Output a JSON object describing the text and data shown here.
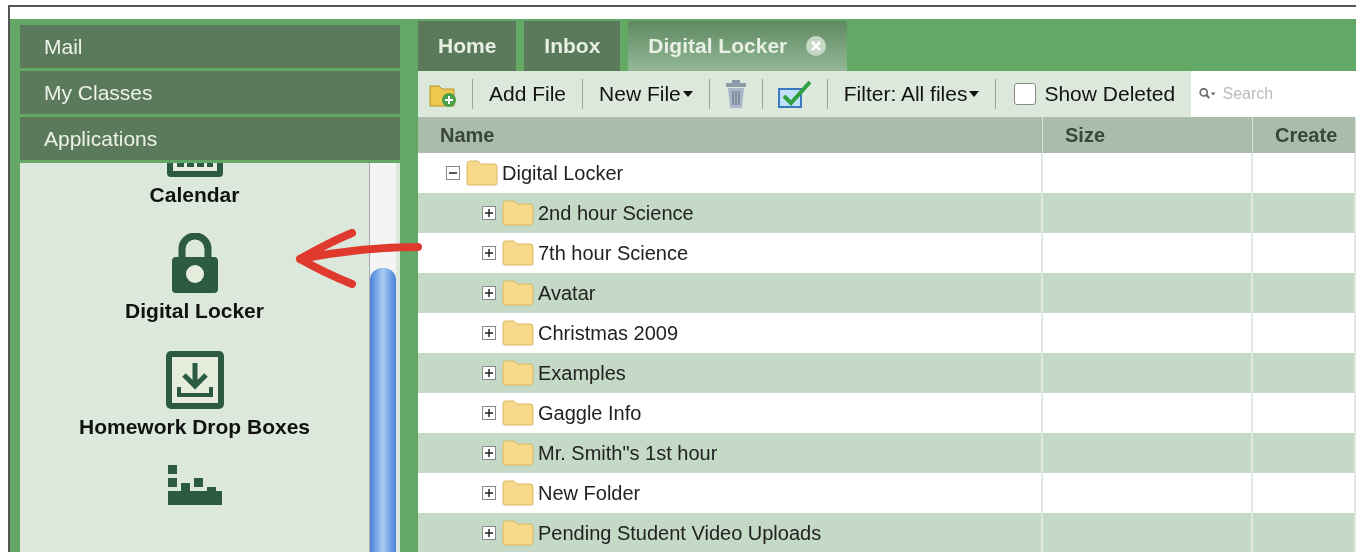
{
  "sidebar": {
    "sections": [
      {
        "label": "Mail"
      },
      {
        "label": "My Classes"
      },
      {
        "label": "Applications"
      }
    ],
    "apps": [
      {
        "kind": "calendar",
        "label": "Calendar"
      },
      {
        "kind": "lock",
        "label": "Digital Locker"
      },
      {
        "kind": "dropbox",
        "label": "Homework Drop Boxes"
      },
      {
        "kind": "pixels"
      }
    ]
  },
  "tabs": [
    {
      "label": "Home",
      "selected": false,
      "closable": false
    },
    {
      "label": "Inbox",
      "selected": false,
      "closable": false
    },
    {
      "label": "Digital Locker",
      "selected": true,
      "closable": true
    }
  ],
  "toolbar": {
    "items": [
      {
        "kind": "icon-folder"
      },
      {
        "kind": "button",
        "label": "Add File"
      },
      {
        "kind": "menu",
        "label": "New File"
      },
      {
        "kind": "icon-trash"
      },
      {
        "kind": "icon-check"
      },
      {
        "kind": "menu",
        "label": "Filter: All files"
      },
      {
        "kind": "checkbox",
        "label": "Show Deleted",
        "checked": false
      }
    ],
    "search": {
      "placeholder": "Search"
    }
  },
  "table": {
    "columns": [
      "Name",
      "Size",
      "Create"
    ],
    "tree": [
      {
        "name": "Digital Locker",
        "expanded": true,
        "children": [
          {
            "name": "2nd hour Science",
            "expanded": false
          },
          {
            "name": "7th hour Science",
            "expanded": false
          },
          {
            "name": "Avatar",
            "expanded": false
          },
          {
            "name": "Christmas 2009",
            "expanded": false
          },
          {
            "name": "Examples",
            "expanded": false
          },
          {
            "name": "Gaggle Info",
            "expanded": false
          },
          {
            "name": "Mr. Smith\"s 1st hour",
            "expanded": false
          },
          {
            "name": "New Folder",
            "expanded": false
          },
          {
            "name": "Pending Student Video Uploads",
            "expanded": false
          }
        ]
      }
    ]
  }
}
